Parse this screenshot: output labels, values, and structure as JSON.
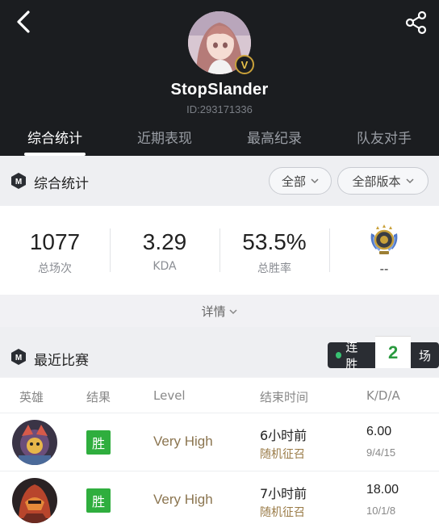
{
  "header": {
    "username": "StopSlander",
    "user_id": "ID:293171336",
    "badge": "V",
    "tabs": [
      {
        "label": "综合统计",
        "active": true
      },
      {
        "label": "近期表现",
        "active": false
      },
      {
        "label": "最高纪录",
        "active": false
      },
      {
        "label": "队友对手",
        "active": false
      }
    ]
  },
  "overview": {
    "title": "综合统计",
    "filter_mode": "全部",
    "filter_version": "全部版本",
    "stats": [
      {
        "value": "1077",
        "label": "总场次"
      },
      {
        "value": "3.29",
        "label": "KDA"
      },
      {
        "value": "53.5%",
        "label": "总胜率"
      }
    ],
    "rank_value": "--",
    "details_label": "详情"
  },
  "recent": {
    "title": "最近比赛",
    "streak_label": "连胜",
    "streak_count": "2",
    "streak_unit": "场",
    "columns": [
      "英雄",
      "结果",
      "Level",
      "结束时间",
      "K/D/A"
    ],
    "matches": [
      {
        "result": "胜",
        "level": "Very High",
        "time": "6小时前",
        "mode": "随机征召",
        "kda": "6.00",
        "kda_detail": "9/4/15"
      },
      {
        "result": "胜",
        "level": "Very High",
        "time": "7小时前",
        "mode": "随机征召",
        "kda": "18.00",
        "kda_detail": "10/1/8"
      }
    ]
  },
  "colors": {
    "header_bg": "#1b1d20",
    "win_green": "#2fae3e",
    "level_text": "#8b7550",
    "streak_green": "#2a9a3f"
  }
}
